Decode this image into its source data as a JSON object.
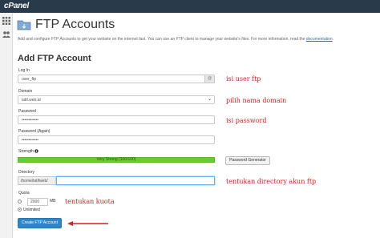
{
  "brand": {
    "logo_text": "cPanel"
  },
  "sidebar": {
    "icons": [
      "grid-icon",
      "users-icon"
    ]
  },
  "header": {
    "title": "FTP Accounts"
  },
  "intro": {
    "text": "Add and configure FTP Accounts to get your website on the internet fast. You can use an FTP client to manage your website's files. For more information, read the ",
    "link": "documentation",
    "suffix": "."
  },
  "form": {
    "section_title": "Add FTP Account",
    "login": {
      "label": "Log In",
      "value": "user_ftp",
      "addon": "@"
    },
    "domain": {
      "label": "Domain",
      "value": "latif.web.id"
    },
    "password": {
      "label": "Password",
      "value": "••••••••••••"
    },
    "password_again": {
      "label": "Password (Again)",
      "value": "••••••••••••"
    },
    "strength": {
      "label": "Strength",
      "bar_text": "Very Strong (100/100)",
      "value": 100
    },
    "password_generator": "Password Generator",
    "directory": {
      "label": "Directory",
      "prefix": "/home/latifweb/",
      "value": ""
    },
    "quota": {
      "label": "Quota",
      "value": "2000",
      "unit": "MB",
      "unlimited_label": "Unlimited"
    },
    "create_button": "Create FTP Account"
  },
  "annotations": {
    "user": "isi user ftp",
    "domain": "pilih nama domain",
    "password": "isi password",
    "directory": "tentukan directory akun ftp",
    "quota": "tentukan kuota"
  },
  "colors": {
    "topbar": "#293a4a",
    "strength": "#66cc33",
    "primary": "#2f86c7",
    "annotation": "#d42020"
  }
}
